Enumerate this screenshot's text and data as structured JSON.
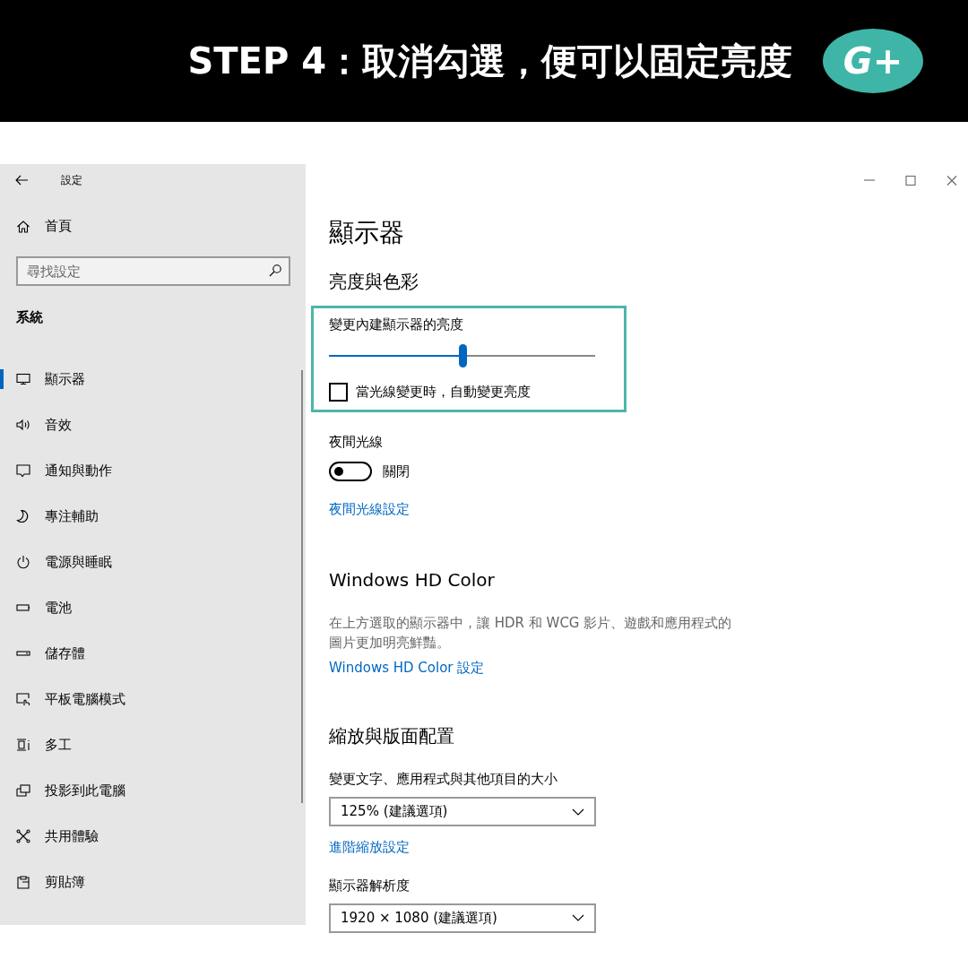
{
  "banner": {
    "title": "STEP 4：取消勾選，便可以固定亮度",
    "logo": "G+"
  },
  "window": {
    "title": "設定"
  },
  "sidebar": {
    "home": "首頁",
    "search": {
      "placeholder": "尋找設定"
    },
    "section": "系統",
    "items": [
      {
        "label": "顯示器",
        "selected": true
      },
      {
        "label": "音效",
        "selected": false
      },
      {
        "label": "通知與動作",
        "selected": false
      },
      {
        "label": "專注輔助",
        "selected": false
      },
      {
        "label": "電源與睡眠",
        "selected": false
      },
      {
        "label": "電池",
        "selected": false
      },
      {
        "label": "儲存體",
        "selected": false
      },
      {
        "label": "平板電腦模式",
        "selected": false
      },
      {
        "label": "多工",
        "selected": false
      },
      {
        "label": "投影到此電腦",
        "selected": false
      },
      {
        "label": "共用體驗",
        "selected": false
      },
      {
        "label": "剪貼簿",
        "selected": false
      }
    ]
  },
  "main": {
    "title": "顯示器",
    "brightness": {
      "heading": "亮度與色彩",
      "slider_label": "變更內建顯示器的亮度",
      "level": 0.5,
      "auto_checkbox": {
        "label": "當光線變更時，自動變更亮度",
        "checked": false
      }
    },
    "night_light": {
      "label": "夜間光線",
      "on": false,
      "state_text": "關閉",
      "link": "夜間光線設定"
    },
    "hd_color": {
      "heading": "Windows HD Color",
      "description": "在上方選取的顯示器中，讓 HDR 和 WCG 影片、遊戲和應用程式的圖片更加明亮鮮豔。",
      "link": "Windows HD Color 設定"
    },
    "scale": {
      "heading": "縮放與版面配置",
      "size_label": "變更文字、應用程式與其他項目的大小",
      "size_value": "125% (建議選項)",
      "advanced_link": "進階縮放設定",
      "resolution_label": "顯示器解析度",
      "resolution_value": "1920 × 1080 (建議選項)"
    }
  }
}
